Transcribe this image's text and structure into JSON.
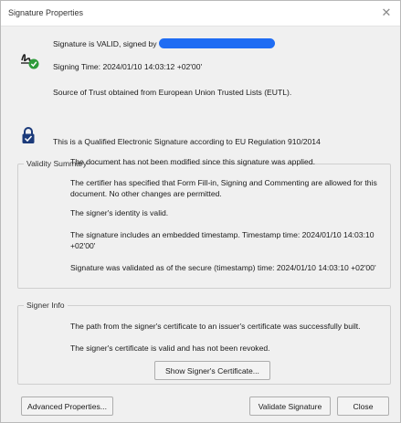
{
  "window": {
    "title": "Signature Properties"
  },
  "header": {
    "status_line": "Signature is VALID, signed by",
    "signing_time": "Signing Time:  2024/01/10 14:03:12 +02'00'",
    "trust_source": "Source of Trust obtained from European Union Trusted Lists (EUTL).",
    "qualified_note": "This is a Qualified Electronic Signature according to EU Regulation 910/2014"
  },
  "validity": {
    "legend": "Validity Summary",
    "items": [
      "The document has not been modified since this signature was applied.",
      "The certifier has specified that Form Fill-in, Signing and Commenting are allowed for this document. No other changes are permitted.",
      "The signer's identity is valid.",
      "The signature includes an embedded timestamp. Timestamp time: 2024/01/10 14:03:10 +02'00'",
      "Signature was validated as of the secure (timestamp) time: 2024/01/10 14:03:10 +02'00'"
    ]
  },
  "signer": {
    "legend": "Signer Info",
    "items": [
      "The path from the signer's certificate to an issuer's certificate was successfully built.",
      "The signer's certificate is valid and has not been revoked."
    ],
    "show_cert_label": "Show Signer's Certificate..."
  },
  "footer": {
    "advanced_label": "Advanced Properties...",
    "validate_label": "Validate Signature",
    "close_label": "Close"
  },
  "icons": {
    "close": "close-icon",
    "signature": "signature-valid-icon",
    "lock": "lock-icon"
  },
  "colors": {
    "redaction": "#1f6cf3",
    "check_green": "#2e9b3a",
    "lock_blue": "#1b3a7a"
  }
}
